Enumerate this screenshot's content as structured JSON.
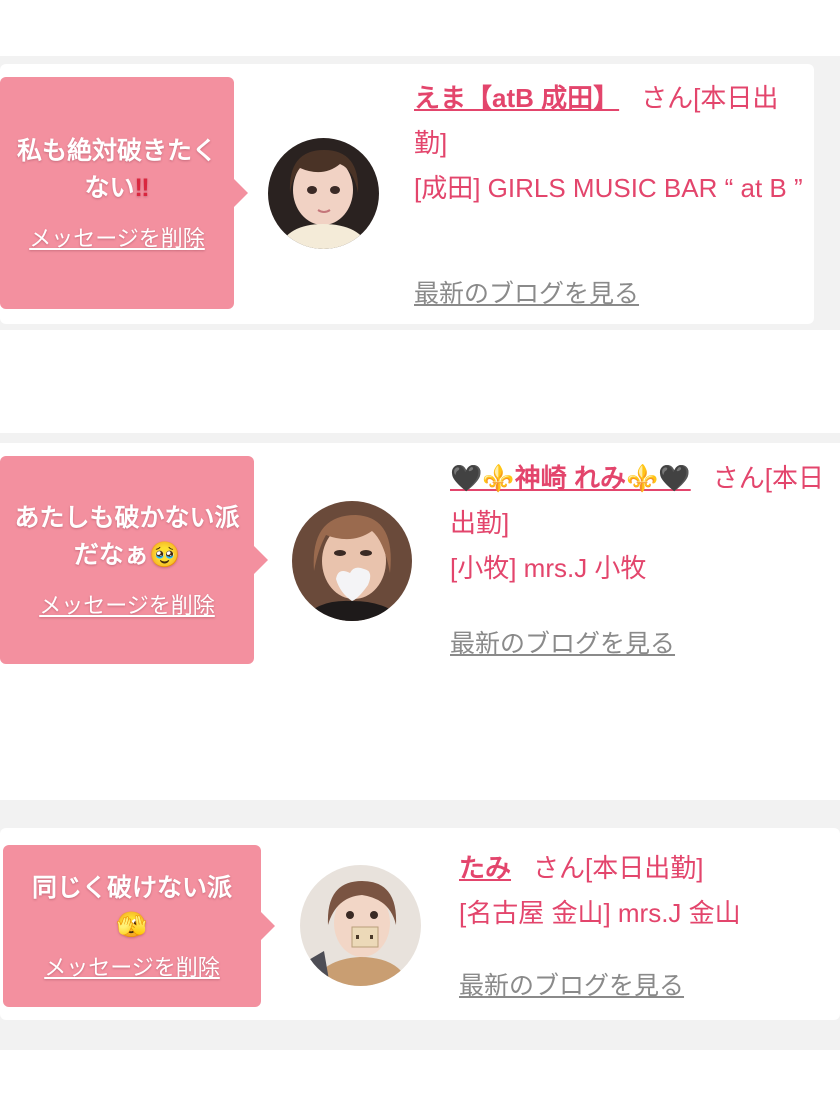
{
  "entries": [
    {
      "message": "私も絶対破きたくない",
      "message_emoji": "‼",
      "delete_label": "メッセージを削除",
      "name": "えま【atB 成田】",
      "honorific": "さん[本日出勤]",
      "store": "[成田] GIRLS MUSIC BAR “ at B ”",
      "blog_label": "最新のブログを見る"
    },
    {
      "message": "あたしも破かない派だなぁ",
      "message_emoji": "🥹",
      "delete_label": "メッセージを削除",
      "name": "🖤⚜️神崎 れみ⚜️🖤",
      "honorific": "さん[本日出勤]",
      "store": "[小牧] mrs.J 小牧",
      "blog_label": "最新のブログを見る"
    },
    {
      "message": "同じく破けない派",
      "message_emoji": "🫣",
      "delete_label": "メッセージを削除",
      "name": "たみ",
      "honorific": "さん[本日出勤]",
      "store": "[名古屋 金山] mrs.J 金山",
      "blog_label": "最新のブログを見る"
    }
  ],
  "colors": {
    "bubble": "#f3909f",
    "accent_text": "#e3456c",
    "link_gray": "#8a8a8a",
    "background_band": "#f2f2f2"
  }
}
